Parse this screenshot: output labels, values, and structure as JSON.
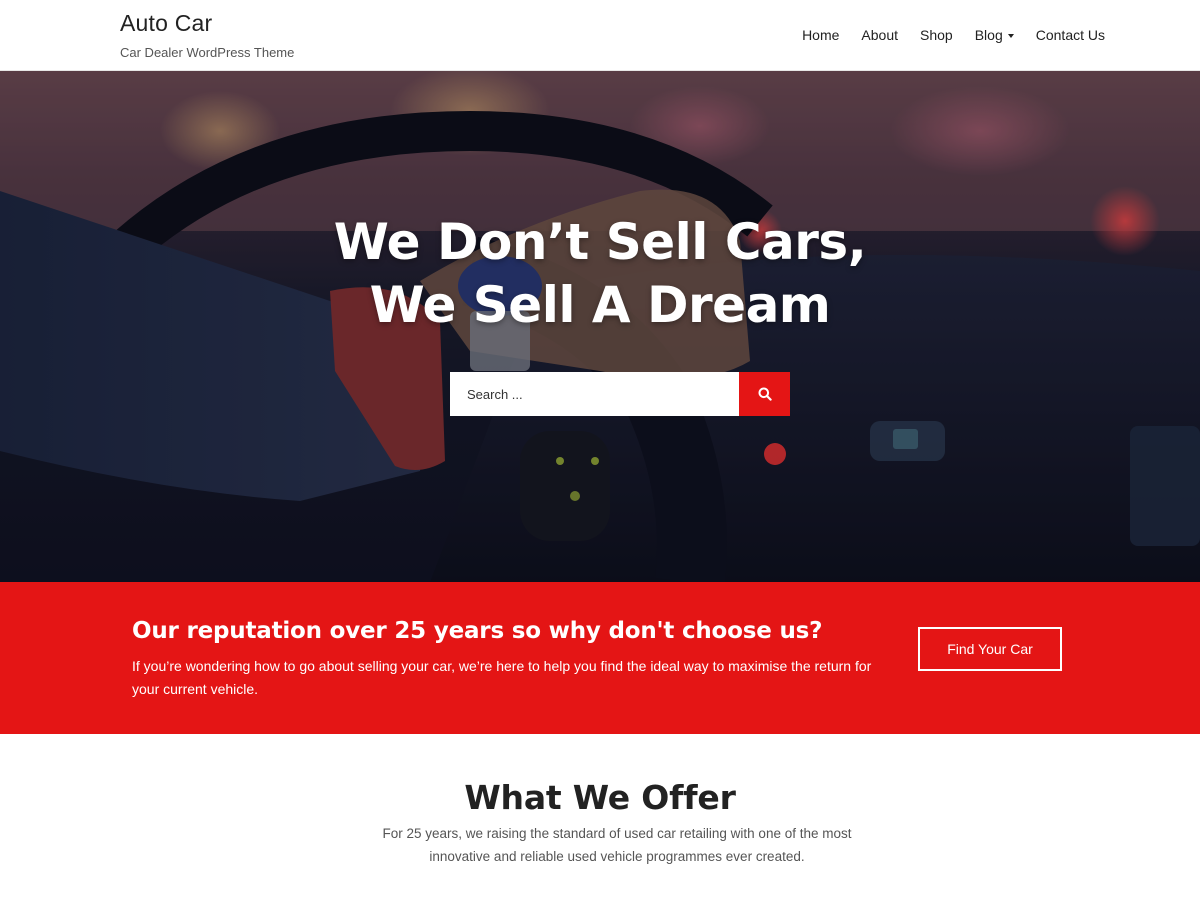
{
  "header": {
    "site_title": "Auto Car",
    "tagline": "Car Dealer WordPress Theme"
  },
  "nav": {
    "items": [
      {
        "label": "Home"
      },
      {
        "label": "About"
      },
      {
        "label": "Shop"
      },
      {
        "label": "Blog",
        "has_dropdown": true
      },
      {
        "label": "Contact Us"
      }
    ]
  },
  "hero": {
    "title_line1": "We Don’t Sell Cars,",
    "title_line2": "We Sell A Dream",
    "search_placeholder": "Search ...",
    "search_icon": "search-icon"
  },
  "cta": {
    "heading": "Our reputation over 25 years so why don't choose us?",
    "text": "If you’re wondering how to go about selling your car, we’re here to help you find the ideal way to maximise the return for your current vehicle.",
    "button_label": "Find Your Car"
  },
  "offer": {
    "title": "What We Offer",
    "text": "For 25 years, we raising the standard of used car retailing with one of the most innovative and reliable used vehicle programmes ever created."
  },
  "colors": {
    "accent": "#e41515",
    "header_bg": "#ffffff",
    "text_dark": "#222222",
    "text_muted": "#555555"
  }
}
